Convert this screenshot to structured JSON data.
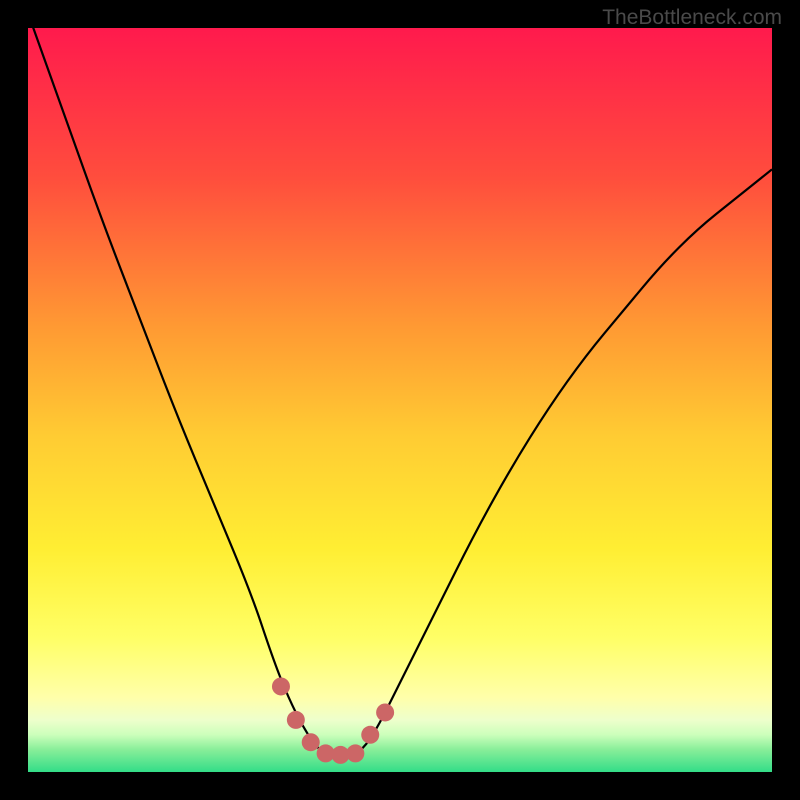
{
  "watermark": "TheBottleneck.com",
  "chart_data": {
    "type": "line",
    "title": "",
    "xlabel": "",
    "ylabel": "",
    "xlim": [
      0,
      100
    ],
    "ylim": [
      0,
      100
    ],
    "series": [
      {
        "name": "bottleneck-curve",
        "x": [
          0,
          5,
          10,
          15,
          20,
          25,
          30,
          33,
          35,
          37,
          39,
          41,
          43,
          45,
          47,
          50,
          55,
          60,
          65,
          70,
          75,
          80,
          85,
          90,
          95,
          100
        ],
        "values": [
          102,
          88,
          74,
          61,
          48,
          36,
          24,
          15,
          10,
          6,
          3,
          2,
          2,
          3,
          6,
          12,
          22,
          32,
          41,
          49,
          56,
          62,
          68,
          73,
          77,
          81
        ]
      }
    ],
    "markers": {
      "name": "optimal-range",
      "x": [
        34.0,
        36.0,
        38.0,
        40.0,
        42.0,
        44.0,
        46.0,
        48.0
      ],
      "values": [
        11.5,
        7.0,
        4.0,
        2.5,
        2.3,
        2.5,
        5.0,
        8.0
      ],
      "color": "#cc6666",
      "radius": 9
    },
    "gradient_stops": [
      {
        "pos": 0,
        "color": "#ff1a4d"
      },
      {
        "pos": 20,
        "color": "#ff4d3d"
      },
      {
        "pos": 40,
        "color": "#ff9933"
      },
      {
        "pos": 55,
        "color": "#ffcc33"
      },
      {
        "pos": 70,
        "color": "#ffee33"
      },
      {
        "pos": 82,
        "color": "#ffff66"
      },
      {
        "pos": 90,
        "color": "#ffffaa"
      },
      {
        "pos": 93,
        "color": "#eeffcc"
      },
      {
        "pos": 95,
        "color": "#ccffbb"
      },
      {
        "pos": 97,
        "color": "#88ee99"
      },
      {
        "pos": 100,
        "color": "#33dd88"
      }
    ]
  }
}
